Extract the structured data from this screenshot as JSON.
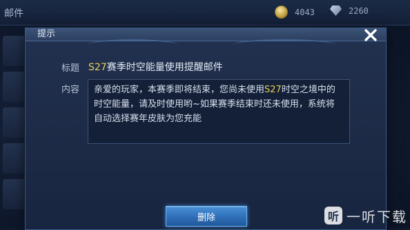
{
  "topbar": {
    "title": "邮件",
    "coins": "4043",
    "coins_icon": "coin-icon",
    "gems": "2260",
    "gems_icon": "diamond-icon"
  },
  "dialog": {
    "title": "提示",
    "close_icon": "close-icon",
    "subject_label": "标题",
    "subject_highlight": "S27",
    "subject_rest": "赛季时空能量使用提醒邮件",
    "content_label": "内容",
    "content_line1_pre": "亲爱的玩家，本赛季即将结束，您尚未使用",
    "content_line1_highlight": "S27",
    "content_line1_post": "时空之境中的",
    "content_line2": "时空能量，请及时使用哟~如果赛季结束时还未使用，系统将",
    "content_line3": "自动选择赛年皮肤为您充能",
    "delete_label": "删除"
  },
  "colors": {
    "highlight": "#e9d25a",
    "button": "#2e6fb8"
  },
  "watermark": {
    "logo_char": "听",
    "text": "一听下载"
  }
}
